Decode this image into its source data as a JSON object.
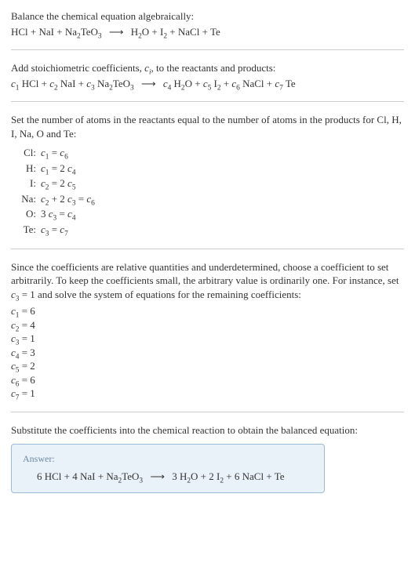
{
  "header": {
    "line1": "Balance the chemical equation algebraically:",
    "eq_lhs_parts": [
      "HCl",
      " + ",
      "NaI",
      " + ",
      "Na",
      "2",
      "TeO",
      "3"
    ],
    "eq_rhs_parts": [
      "H",
      "2",
      "O",
      " + ",
      "I",
      "2",
      " + ",
      "NaCl",
      " + ",
      "Te"
    ],
    "arrow": "⟶"
  },
  "stoich": {
    "intro_a": "Add stoichiometric coefficients, ",
    "intro_ci": "c",
    "intro_ci_sub": "i",
    "intro_b": ", to the reactants and products:",
    "lhs": [
      {
        "c": "c",
        "i": "1",
        "sp": " HCl"
      },
      {
        "plus": " + "
      },
      {
        "c": "c",
        "i": "2",
        "sp": " NaI"
      },
      {
        "plus": " + "
      },
      {
        "c": "c",
        "i": "3",
        "sp": " Na",
        "sub": "2",
        "tail": "TeO",
        "sub2": "3"
      }
    ],
    "arrow": "⟶",
    "rhs": [
      {
        "c": "c",
        "i": "4",
        "sp": " H",
        "sub": "2",
        "tail": "O"
      },
      {
        "plus": " + "
      },
      {
        "c": "c",
        "i": "5",
        "sp": " I",
        "sub": "2"
      },
      {
        "plus": " + "
      },
      {
        "c": "c",
        "i": "6",
        "sp": " NaCl"
      },
      {
        "plus": " + "
      },
      {
        "c": "c",
        "i": "7",
        "sp": " Te"
      }
    ]
  },
  "atoms": {
    "intro": "Set the number of atoms in the reactants equal to the number of atoms in the products for Cl, H, I, Na, O and Te:",
    "rows": [
      {
        "el": "Cl:",
        "lhs": [
          {
            "c": "c",
            "i": "1"
          }
        ],
        "eq": " = ",
        "rhs": [
          {
            "c": "c",
            "i": "6"
          }
        ]
      },
      {
        "el": "H:",
        "lhs": [
          {
            "c": "c",
            "i": "1"
          }
        ],
        "eq": " = ",
        "rhs": [
          {
            "n": "2 "
          },
          {
            "c": "c",
            "i": "4"
          }
        ]
      },
      {
        "el": "I:",
        "lhs": [
          {
            "c": "c",
            "i": "2"
          }
        ],
        "eq": " = ",
        "rhs": [
          {
            "n": "2 "
          },
          {
            "c": "c",
            "i": "5"
          }
        ]
      },
      {
        "el": "Na:",
        "lhs": [
          {
            "c": "c",
            "i": "2"
          },
          {
            "n": " + 2 "
          },
          {
            "c": "c",
            "i": "3"
          }
        ],
        "eq": " = ",
        "rhs": [
          {
            "c": "c",
            "i": "6"
          }
        ]
      },
      {
        "el": "O:",
        "lhs": [
          {
            "n": "3 "
          },
          {
            "c": "c",
            "i": "3"
          }
        ],
        "eq": " = ",
        "rhs": [
          {
            "c": "c",
            "i": "4"
          }
        ]
      },
      {
        "el": "Te:",
        "lhs": [
          {
            "c": "c",
            "i": "3"
          }
        ],
        "eq": " = ",
        "rhs": [
          {
            "c": "c",
            "i": "7"
          }
        ]
      }
    ]
  },
  "solve": {
    "para_a": "Since the coefficients are relative quantities and underdetermined, choose a coefficient to set arbitrarily. To keep the coefficients small, the arbitrary value is ordinarily one. For instance, set ",
    "c3": "c",
    "c3_sub": "3",
    "para_b": " = 1 and solve the system of equations for the remaining coefficients:",
    "coeffs": [
      {
        "c": "c",
        "i": "1",
        "v": " = 6"
      },
      {
        "c": "c",
        "i": "2",
        "v": " = 4"
      },
      {
        "c": "c",
        "i": "3",
        "v": " = 1"
      },
      {
        "c": "c",
        "i": "4",
        "v": " = 3"
      },
      {
        "c": "c",
        "i": "5",
        "v": " = 2"
      },
      {
        "c": "c",
        "i": "6",
        "v": " = 6"
      },
      {
        "c": "c",
        "i": "7",
        "v": " = 1"
      }
    ]
  },
  "final": {
    "intro": "Substitute the coefficients into the chemical reaction to obtain the balanced equation:",
    "answer_label": "Answer:",
    "lhs": [
      "6 HCl",
      " + ",
      "4 NaI",
      " + ",
      "Na",
      "2",
      "TeO",
      "3"
    ],
    "arrow": "⟶",
    "rhs": [
      "3 H",
      "2",
      "O",
      " + ",
      "2 I",
      "2",
      "",
      " + ",
      "6 NaCl",
      " + ",
      "Te"
    ]
  }
}
